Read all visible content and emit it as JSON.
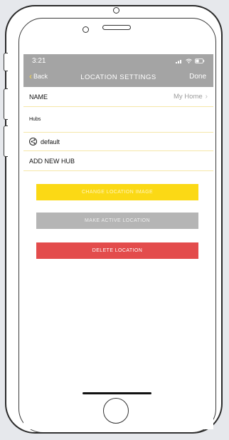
{
  "status_bar": {
    "time": "3:21",
    "icons": "signal wifi battery"
  },
  "nav": {
    "back_label": "Back",
    "title": "LOCATION SETTINGS",
    "done_label": "Done"
  },
  "name_row": {
    "label": "NAME",
    "value": "My Home"
  },
  "hubs": {
    "section_label": "Hubs",
    "items": [
      {
        "label": "default"
      }
    ]
  },
  "add_hub": {
    "label": "ADD NEW HUB"
  },
  "buttons": {
    "change_image": "CHANGE LOCATION IMAGE",
    "make_active": "MAKE ACTIVE LOCATION",
    "delete": "DELETE LOCATION"
  },
  "colors": {
    "accent": "#fbd915",
    "danger": "#e34c4c",
    "disabled": "#b5b5b5",
    "navbar": "#a4a4a4"
  }
}
